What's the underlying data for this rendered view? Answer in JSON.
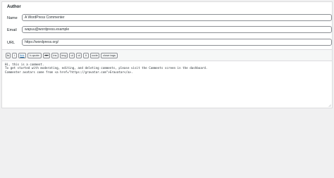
{
  "author_box": {
    "title": "Author",
    "name_label": "Name",
    "name_value": "A WordPress Commenter",
    "email_label": "Email",
    "email_value": "wapuu@wordpress.example",
    "url_label": "URL",
    "url_value": "https://wordpress.org/"
  },
  "toolbar": {
    "buttons": [
      {
        "label": "b"
      },
      {
        "label": "i"
      },
      {
        "label": "link"
      },
      {
        "label": "b-quote"
      },
      {
        "label": "del"
      },
      {
        "label": "ins"
      },
      {
        "label": "img"
      },
      {
        "label": "ul"
      },
      {
        "label": "ol"
      },
      {
        "label": "li"
      },
      {
        "label": "code"
      },
      {
        "label": "close tags"
      }
    ]
  },
  "comment": {
    "text": "Hi, this is a comment.\nTo get started with moderating, editing, and deleting comments, please visit the Comments screen in the dashboard.\nCommenter avatars come from <a href=\"https://gravatar.com\">Gravatar</a>."
  }
}
